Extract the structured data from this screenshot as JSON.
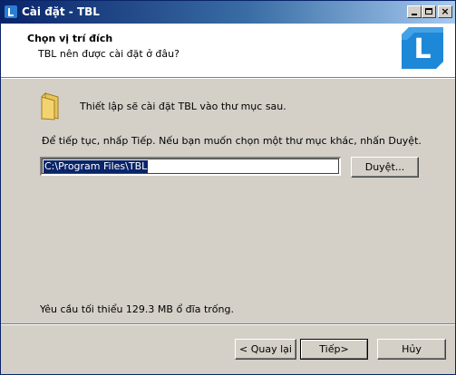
{
  "window": {
    "title": "Cài đặt - TBL",
    "controls": {
      "minimize_icon": "minimize-icon",
      "maximize_icon": "maximize-icon",
      "close_label": "×"
    }
  },
  "header": {
    "title": "Chọn vị trí đích",
    "subtitle": "TBL nên được cài đặt ở đâu?",
    "logo_letter": "L",
    "logo_color": "#1e88d8"
  },
  "content": {
    "intro": "Thiết lập sẽ cài đặt TBL vào thư mục sau.",
    "instruction": "Để tiếp tục, nhấp Tiếp.  Nếu bạn muốn chọn một thư mục khác, nhấn Duyệt.",
    "path_value": "C:\\Program Files\\TBL",
    "browse_label": "Duyệt...",
    "space_required": "Yêu cầu tối thiểu 129.3 MB ổ đĩa trống."
  },
  "footer": {
    "back_label": "< Quay lại",
    "next_label": "Tiếp>",
    "cancel_label": "Hủy"
  },
  "colors": {
    "titlebar_start": "#0a246a",
    "dialog_bg": "#d4d0c8",
    "selection": "#0a246a"
  }
}
